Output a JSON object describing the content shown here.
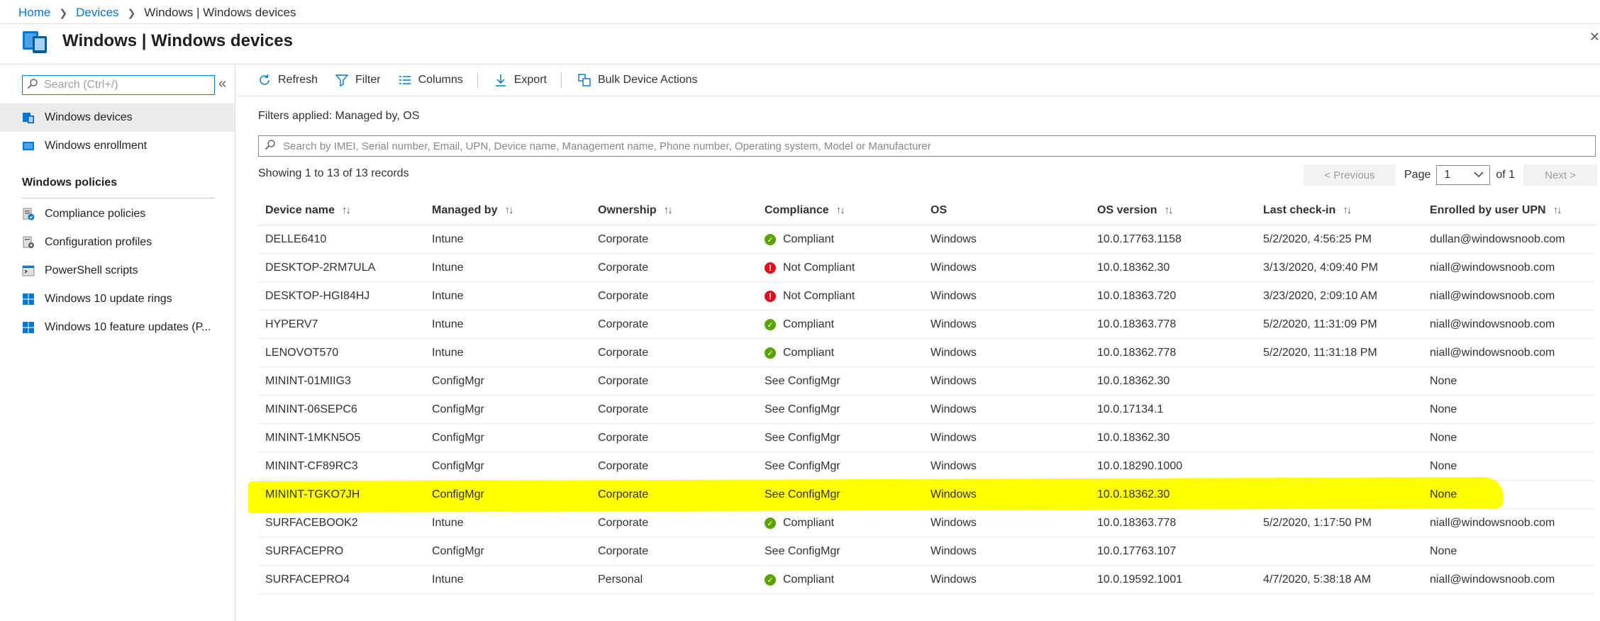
{
  "breadcrumb": {
    "home": "Home",
    "devices": "Devices",
    "current": "Windows | Windows devices"
  },
  "page_title": "Windows | Windows devices",
  "left": {
    "search_placeholder": "Search (Ctrl+/)",
    "items": [
      {
        "label": "Windows devices",
        "icon": "device-icon",
        "active": true
      },
      {
        "label": "Windows enrollment",
        "icon": "enrollment-icon"
      }
    ],
    "section": "Windows policies",
    "policy_items": [
      {
        "label": "Compliance policies",
        "icon": "compliance-policy-icon"
      },
      {
        "label": "Configuration profiles",
        "icon": "configuration-profile-icon"
      },
      {
        "label": "PowerShell scripts",
        "icon": "powershell-icon"
      },
      {
        "label": "Windows 10 update rings",
        "icon": "windows-logo-icon"
      },
      {
        "label": "Windows 10 feature updates (P...",
        "icon": "windows-logo-icon"
      }
    ]
  },
  "toolbar": {
    "refresh": "Refresh",
    "filter": "Filter",
    "columns": "Columns",
    "export": "Export",
    "bulk": "Bulk Device Actions"
  },
  "filters_applied": "Filters applied: Managed by, OS",
  "search_placeholder": "Search by IMEI, Serial number, Email, UPN, Device name, Management name, Phone number, Operating system, Model or Manufacturer",
  "showing": "Showing 1 to 13 of 13 records",
  "pager": {
    "previous": "< Previous",
    "page_label": "Page",
    "page_value": "1",
    "of": "of 1",
    "next": "Next >"
  },
  "columns": [
    "Device name",
    "Managed by",
    "Ownership",
    "Compliance",
    "OS",
    "OS version",
    "Last check-in",
    "Enrolled by user UPN"
  ],
  "rows": [
    {
      "device": "DELLE6410",
      "managed": "Intune",
      "ownership": "Corporate",
      "compliance": "Compliant",
      "status": "ok",
      "os": "Windows",
      "version": "10.0.17763.1158",
      "checkin": "5/2/2020, 4:56:25 PM",
      "upn": "dullan@windowsnoob.com"
    },
    {
      "device": "DESKTOP-2RM7ULA",
      "managed": "Intune",
      "ownership": "Corporate",
      "compliance": "Not Compliant",
      "status": "bad",
      "os": "Windows",
      "version": "10.0.18362.30",
      "checkin": "3/13/2020, 4:09:40 PM",
      "upn": "niall@windowsnoob.com"
    },
    {
      "device": "DESKTOP-HGI84HJ",
      "managed": "Intune",
      "ownership": "Corporate",
      "compliance": "Not Compliant",
      "status": "bad",
      "os": "Windows",
      "version": "10.0.18363.720",
      "checkin": "3/23/2020, 2:09:10 AM",
      "upn": "niall@windowsnoob.com"
    },
    {
      "device": "HYPERV7",
      "managed": "Intune",
      "ownership": "Corporate",
      "compliance": "Compliant",
      "status": "ok",
      "os": "Windows",
      "version": "10.0.18363.778",
      "checkin": "5/2/2020, 11:31:09 PM",
      "upn": "niall@windowsnoob.com"
    },
    {
      "device": "LENOVOT570",
      "managed": "Intune",
      "ownership": "Corporate",
      "compliance": "Compliant",
      "status": "ok",
      "os": "Windows",
      "version": "10.0.18362.778",
      "checkin": "5/2/2020, 11:31:18 PM",
      "upn": "niall@windowsnoob.com"
    },
    {
      "device": "MININT-01MIIG3",
      "managed": "ConfigMgr",
      "ownership": "Corporate",
      "compliance": "See ConfigMgr",
      "status": "",
      "os": "Windows",
      "version": "10.0.18362.30",
      "checkin": "",
      "upn": "None"
    },
    {
      "device": "MININT-06SEPC6",
      "managed": "ConfigMgr",
      "ownership": "Corporate",
      "compliance": "See ConfigMgr",
      "status": "",
      "os": "Windows",
      "version": "10.0.17134.1",
      "checkin": "",
      "upn": "None"
    },
    {
      "device": "MININT-1MKN5O5",
      "managed": "ConfigMgr",
      "ownership": "Corporate",
      "compliance": "See ConfigMgr",
      "status": "",
      "os": "Windows",
      "version": "10.0.18362.30",
      "checkin": "",
      "upn": "None"
    },
    {
      "device": "MININT-CF89RC3",
      "managed": "ConfigMgr",
      "ownership": "Corporate",
      "compliance": "See ConfigMgr",
      "status": "",
      "os": "Windows",
      "version": "10.0.18290.1000",
      "checkin": "",
      "upn": "None"
    },
    {
      "device": "MININT-TGKO7JH",
      "managed": "ConfigMgr",
      "ownership": "Corporate",
      "compliance": "See ConfigMgr",
      "status": "",
      "os": "Windows",
      "version": "10.0.18362.30",
      "checkin": "",
      "upn": "None",
      "highlighted": true
    },
    {
      "device": "SURFACEBOOK2",
      "managed": "Intune",
      "ownership": "Corporate",
      "compliance": "Compliant",
      "status": "ok",
      "os": "Windows",
      "version": "10.0.18363.778",
      "checkin": "5/2/2020, 1:17:50 PM",
      "upn": "niall@windowsnoob.com"
    },
    {
      "device": "SURFACEPRO",
      "managed": "ConfigMgr",
      "ownership": "Corporate",
      "compliance": "See ConfigMgr",
      "status": "",
      "os": "Windows",
      "version": "10.0.17763.107",
      "checkin": "",
      "upn": "None"
    },
    {
      "device": "SURFACEPRO4",
      "managed": "Intune",
      "ownership": "Personal",
      "compliance": "Compliant",
      "status": "ok",
      "os": "Windows",
      "version": "10.0.19592.1001",
      "checkin": "4/7/2020, 5:38:18 AM",
      "upn": "niall@windowsnoob.com"
    }
  ],
  "colors": {
    "accent": "#0078d4",
    "compliant": "#57a300",
    "not_compliant": "#e00b1c",
    "highlight": "#ffff00"
  }
}
